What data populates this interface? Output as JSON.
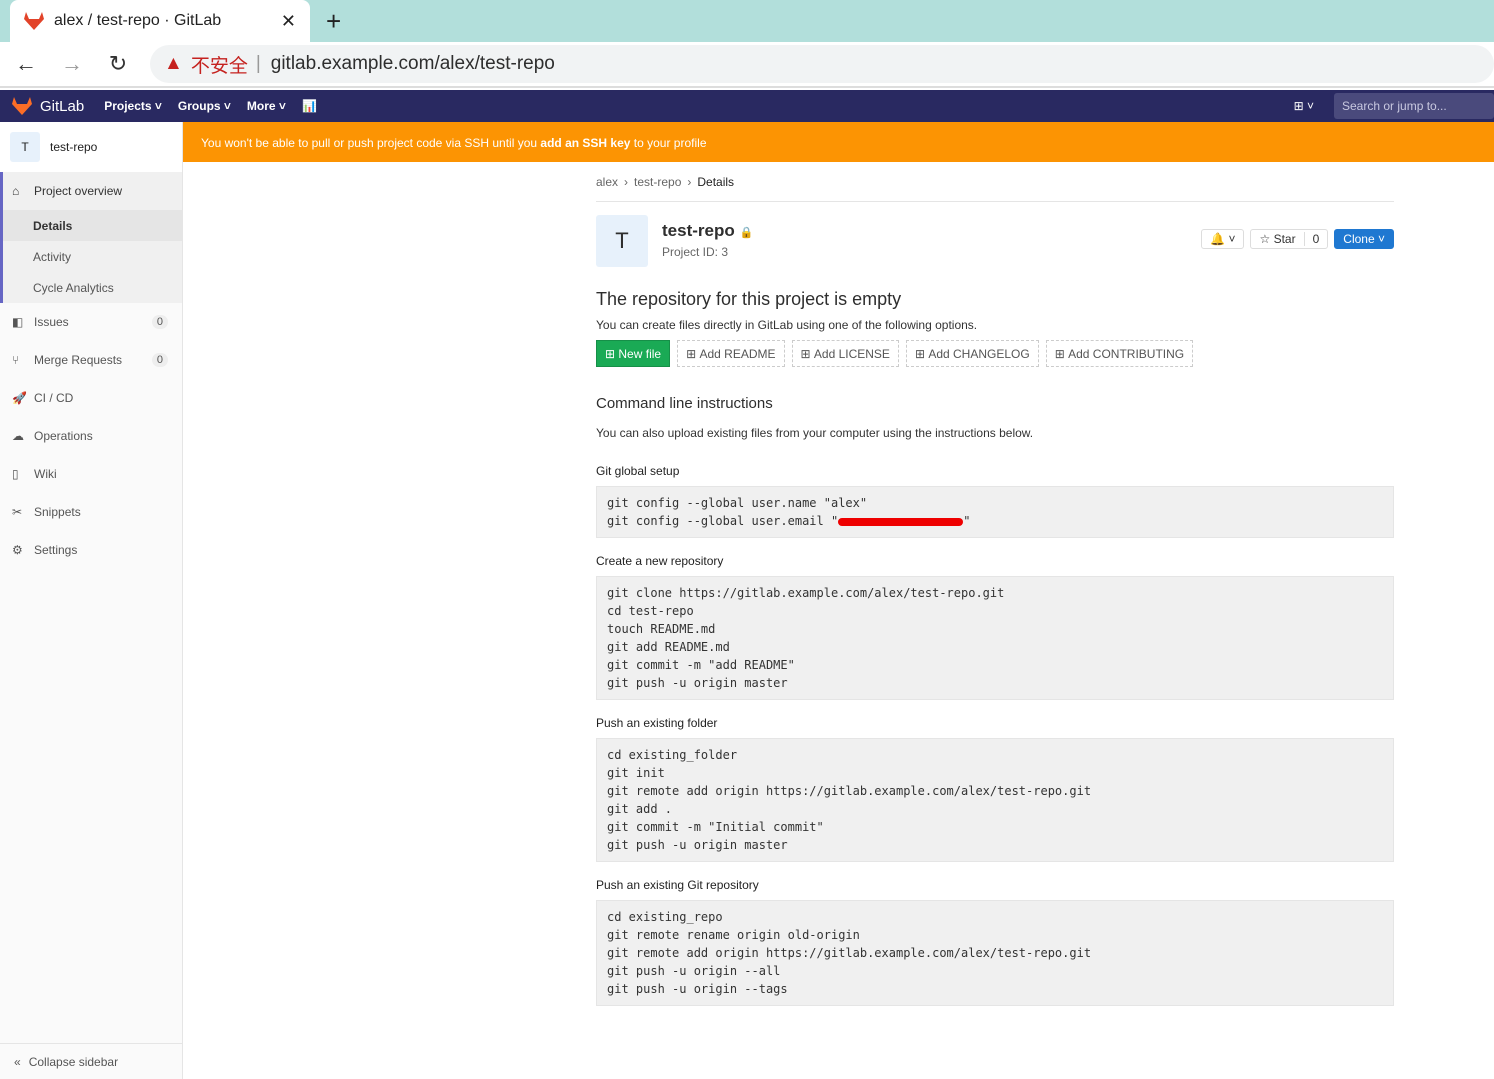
{
  "browser": {
    "tab_title": "alex / test-repo · GitLab",
    "insecure": "不安全",
    "url": "gitlab.example.com/alex/test-repo"
  },
  "nav": {
    "brand": "GitLab",
    "projects": "Projects",
    "groups": "Groups",
    "more": "More",
    "search_placeholder": "Search or jump to..."
  },
  "sidebar": {
    "project_initial": "T",
    "project_name": "test-repo",
    "overview": "Project overview",
    "sub": [
      "Details",
      "Activity",
      "Cycle Analytics"
    ],
    "items": [
      {
        "label": "Issues",
        "count": "0"
      },
      {
        "label": "Merge Requests",
        "count": "0"
      },
      {
        "label": "CI / CD"
      },
      {
        "label": "Operations"
      },
      {
        "label": "Wiki"
      },
      {
        "label": "Snippets"
      },
      {
        "label": "Settings"
      }
    ],
    "collapse": "Collapse sidebar"
  },
  "banner": {
    "pre": "You won't be able to pull or push project code via SSH until you ",
    "link": "add an SSH key",
    "post": " to your profile"
  },
  "breadcrumb": [
    "alex",
    "test-repo",
    "Details"
  ],
  "project": {
    "initial": "T",
    "name": "test-repo",
    "id": "Project ID: 3",
    "star": "Star",
    "star_count": "0",
    "clone": "Clone"
  },
  "empty": {
    "title": "The repository for this project is empty",
    "desc": "You can create files directly in GitLab using one of the following options.",
    "buttons": [
      "New file",
      "Add README",
      "Add LICENSE",
      "Add CHANGELOG",
      "Add CONTRIBUTING"
    ]
  },
  "cli": {
    "title": "Command line instructions",
    "desc": "You can also upload existing files from your computer using the instructions below.",
    "global_title": "Git global setup",
    "global_line1": "git config --global user.name \"alex\"",
    "global_line2": "git config --global user.email \"",
    "new_title": "Create a new repository",
    "new_code": "git clone https://gitlab.example.com/alex/test-repo.git\ncd test-repo\ntouch README.md\ngit add README.md\ngit commit -m \"add README\"\ngit push -u origin master",
    "folder_title": "Push an existing folder",
    "folder_code": "cd existing_folder\ngit init\ngit remote add origin https://gitlab.example.com/alex/test-repo.git\ngit add .\ngit commit -m \"Initial commit\"\ngit push -u origin master",
    "repo_title": "Push an existing Git repository",
    "repo_code": "cd existing_repo\ngit remote rename origin old-origin\ngit remote add origin https://gitlab.example.com/alex/test-repo.git\ngit push -u origin --all\ngit push -u origin --tags"
  }
}
